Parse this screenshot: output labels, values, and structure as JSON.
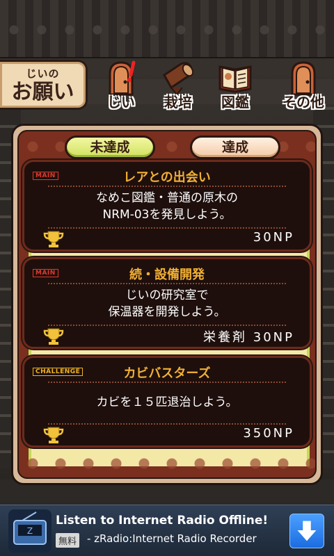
{
  "header": {
    "title_small": "じいの",
    "title_big": "お願い",
    "tabs": [
      {
        "label": "じい",
        "icon": "door-alert-icon",
        "active": true
      },
      {
        "label": "栽培",
        "icon": "log-icon",
        "active": false
      },
      {
        "label": "図鑑",
        "icon": "book-icon",
        "active": false
      },
      {
        "label": "その他",
        "icon": "door-icon",
        "active": false
      }
    ]
  },
  "filters": {
    "incomplete": "未達成",
    "complete": "達成"
  },
  "missions": [
    {
      "tag": "MAIN",
      "title": "レアとの出会い",
      "description": "なめこ図鑑・普通の原木の\nNRM-03を発見しよう。",
      "reward": "30NP"
    },
    {
      "tag": "MAIN",
      "title": "続・設備開発",
      "description": "じいの研究室で\n保温器を開発しよう。",
      "reward": "栄養剤 30NP"
    },
    {
      "tag": "CHALLENGE",
      "title": "カビバスターズ",
      "description": "カビを１５匹退治しよう。",
      "reward": "350NP"
    }
  ],
  "ad": {
    "headline": "Listen to Internet Radio Offline!",
    "free_badge": "無料",
    "subtitle": "- zRadio:Internet Radio Recorder",
    "icon": "radio-app-icon"
  },
  "colors": {
    "accent_title": "#f2b035",
    "main_tag": "#e13a2a",
    "challenge_tag": "#f0b422",
    "panel_frame": "#7a2f1f"
  }
}
